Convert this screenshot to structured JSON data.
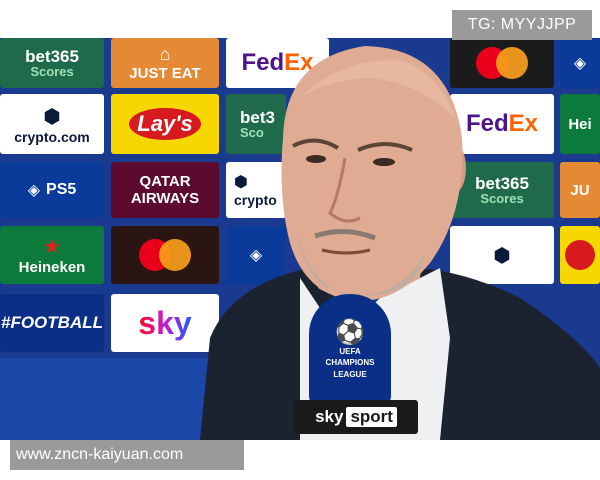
{
  "watermarks": {
    "top_right": "TG: MYYJJPP",
    "bottom_left": "www.zncn-kaiyuan.com"
  },
  "board": {
    "bet365_main": "bet365",
    "bet365_sub": "Scores",
    "just_eat": "JUST EAT",
    "fedex_fe": "Fed",
    "fedex_ex": "Ex",
    "crypto": "crypto.com",
    "lays": "Lay's",
    "qatar_1": "QATAR",
    "qatar_2": "AIRWAYS",
    "ps5": "PS5",
    "heineken": "Heineken",
    "football": "#FOOTBALL",
    "sky": "sky",
    "heineken_partial": "Hei",
    "justeat_partial": "JU",
    "crypto_partial": "crypto",
    "bet_partial": "bet3",
    "bet_partial_sub": "Sco"
  },
  "microphone": {
    "ball_icon": "champions-league-star-ball",
    "label_1": "UEFA",
    "label_2": "CHAMPIONS",
    "label_3": "LEAGUE"
  },
  "mic_flag": {
    "sky": "sky",
    "sport": "sport"
  },
  "colors": {
    "board_blue": "#1a47a8",
    "suit": "#1c2330",
    "shirt": "#eef0f2",
    "watermark_bg": "#9a9a9a"
  }
}
